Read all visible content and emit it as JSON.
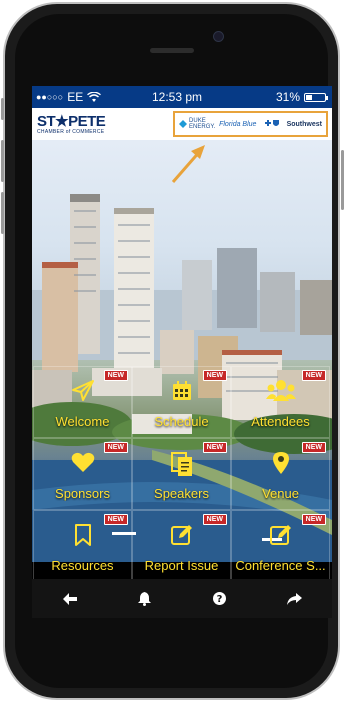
{
  "status_bar": {
    "signal": "●●○○○",
    "carrier": "EE",
    "wifi_icon": "wifi-icon",
    "time": "12:53 pm",
    "battery": "31%",
    "battery_level": 0.31
  },
  "header": {
    "logo_text": "ST★PETE",
    "logo_subtext": "CHAMBER of COMMERCE",
    "sponsors": [
      "DUKE ENERGY.",
      "Florida Blue",
      "Southwest"
    ],
    "accent_color": "#e8a33b"
  },
  "tiles": [
    {
      "label": "Welcome",
      "icon": "paper-plane-icon",
      "badge": "NEW"
    },
    {
      "label": "Schedule",
      "icon": "calendar-icon",
      "badge": "NEW"
    },
    {
      "label": "Attendees",
      "icon": "users-icon",
      "badge": "NEW"
    },
    {
      "label": "Sponsors",
      "icon": "heart-icon",
      "badge": "NEW"
    },
    {
      "label": "Speakers",
      "icon": "document-icon",
      "badge": "NEW"
    },
    {
      "label": "Venue",
      "icon": "map-pin-icon",
      "badge": "NEW"
    },
    {
      "label": "Resources",
      "icon": "bookmark-icon",
      "badge": "NEW"
    },
    {
      "label": "Report Issue",
      "icon": "edit-icon",
      "badge": "NEW"
    },
    {
      "label": "Conference S...",
      "icon": "edit-icon",
      "badge": "NEW"
    }
  ],
  "bottom_nav": [
    "back-arrow-icon",
    "bell-icon",
    "help-icon",
    "share-icon"
  ],
  "colors": {
    "tile_text": "#ffe032",
    "badge": "#c62828",
    "status_bar": "#063a86"
  }
}
